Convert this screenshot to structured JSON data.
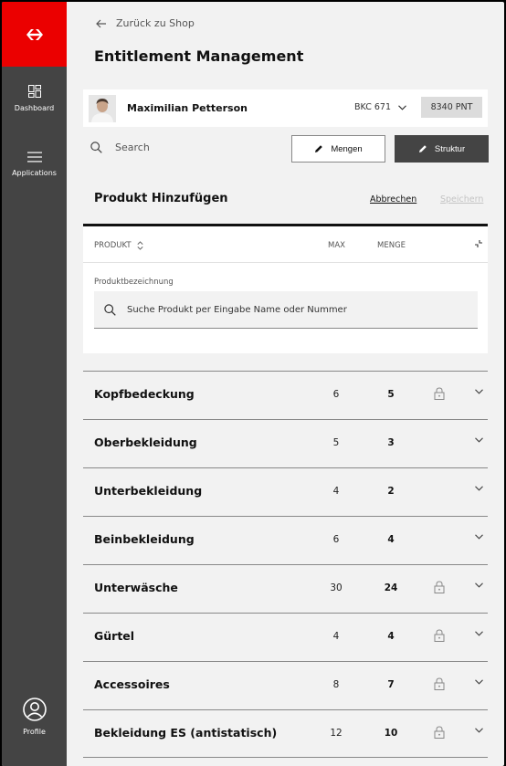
{
  "sidebar": {
    "items": [
      {
        "label": "Dashboard",
        "icon": "dashboard-icon"
      },
      {
        "label": "Applications",
        "icon": "menu-icon"
      }
    ],
    "profile_label": "Profile",
    "brand_color": "#eb0000"
  },
  "header": {
    "back_label": "Zurück zu Shop",
    "title": "Entitlement Management"
  },
  "user": {
    "name": "Maximilian Petterson",
    "account": "BKC 671",
    "points": "8340 PNT"
  },
  "toolbar": {
    "search_placeholder": "Search",
    "mengen_label": "Mengen",
    "struktur_label": "Struktur"
  },
  "add_product": {
    "title": "Produkt Hinzufügen",
    "cancel_label": "Abbrechen",
    "save_label": "Speichern"
  },
  "table": {
    "col_product": "PRODUKT",
    "col_max": "MAX",
    "col_menge": "MENGE",
    "field_label": "Produktbezeichnung",
    "field_placeholder": "Suche Produkt per Eingabe Name oder Nummer"
  },
  "categories": [
    {
      "name": "Kopfbedeckung",
      "max": "6",
      "menge": "5",
      "locked": true
    },
    {
      "name": "Oberbekleidung",
      "max": "5",
      "menge": "3",
      "locked": false
    },
    {
      "name": "Unterbekleidung",
      "max": "4",
      "menge": "2",
      "locked": false
    },
    {
      "name": "Beinbekleidung",
      "max": "6",
      "menge": "4",
      "locked": false
    },
    {
      "name": "Unterwäsche",
      "max": "30",
      "menge": "24",
      "locked": true
    },
    {
      "name": "Gürtel",
      "max": "4",
      "menge": "4",
      "locked": true
    },
    {
      "name": "Accessoires",
      "max": "8",
      "menge": "7",
      "locked": true
    },
    {
      "name": "Bekleidung ES (antistatisch)",
      "max": "12",
      "menge": "10",
      "locked": true
    }
  ]
}
